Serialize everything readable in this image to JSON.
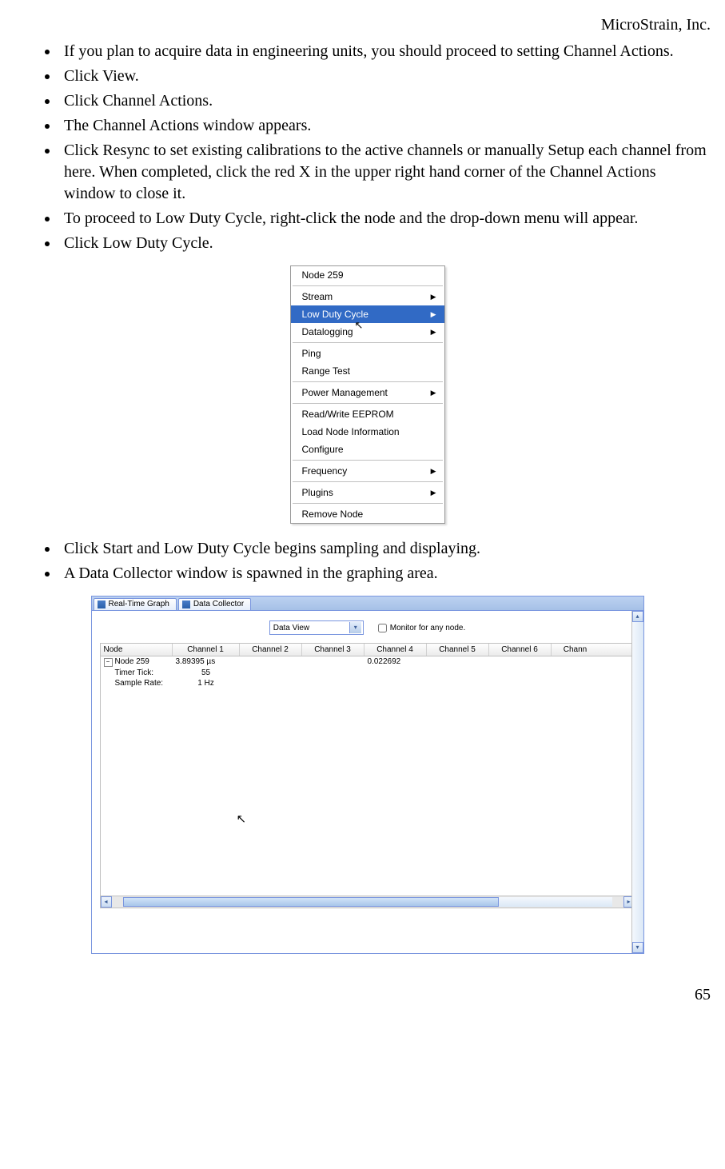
{
  "header": {
    "company": "MicroStrain, Inc."
  },
  "bullets_top": [
    "If you plan to acquire data in engineering units, you should proceed to setting Channel Actions.",
    "Click View.",
    "Click Channel Actions.",
    "The Channel Actions window appears.",
    "Click Resync to set existing calibrations to the active channels or manually Setup each channel from here. When completed, click the red X in the upper right hand corner of the Channel Actions window to close it.",
    "To proceed to Low Duty Cycle, right-click the node and the drop-down menu will appear.",
    "Click Low Duty Cycle."
  ],
  "context_menu": {
    "title": "Node 259",
    "groups": [
      [
        {
          "label": "Stream",
          "submenu": true
        },
        {
          "label": "Low Duty Cycle",
          "submenu": true,
          "highlight": true
        },
        {
          "label": "Datalogging",
          "submenu": true
        }
      ],
      [
        {
          "label": "Ping",
          "submenu": false
        },
        {
          "label": "Range Test",
          "submenu": false
        }
      ],
      [
        {
          "label": "Power Management",
          "submenu": true
        }
      ],
      [
        {
          "label": "Read/Write EEPROM",
          "submenu": false
        },
        {
          "label": "Load Node Information",
          "submenu": false
        },
        {
          "label": "Configure",
          "submenu": false
        }
      ],
      [
        {
          "label": "Frequency",
          "submenu": true
        }
      ],
      [
        {
          "label": "Plugins",
          "submenu": true
        }
      ],
      [
        {
          "label": "Remove Node",
          "submenu": false
        }
      ]
    ]
  },
  "bullets_mid": [
    "Click Start and Low Duty Cycle begins sampling and displaying.",
    "A Data Collector window is spawned in the graphing area."
  ],
  "data_collector": {
    "tabs": [
      "Real-Time Graph",
      "Data Collector"
    ],
    "active_tab": 1,
    "view_select": "Data View",
    "monitor_label": "Monitor for any node.",
    "columns": [
      "Node",
      "Channel 1",
      "Channel 2",
      "Channel 3",
      "Channel 4",
      "Channel 5",
      "Channel 6",
      "Chann"
    ],
    "tree": {
      "node": "Node 259",
      "children": [
        {
          "label": "Timer Tick:",
          "value": "55"
        },
        {
          "label": "Sample Rate:",
          "value": "1 Hz"
        }
      ],
      "ch1_value": "3.89395 µs",
      "ch4_value": "0.022692"
    }
  },
  "page_number": "65"
}
